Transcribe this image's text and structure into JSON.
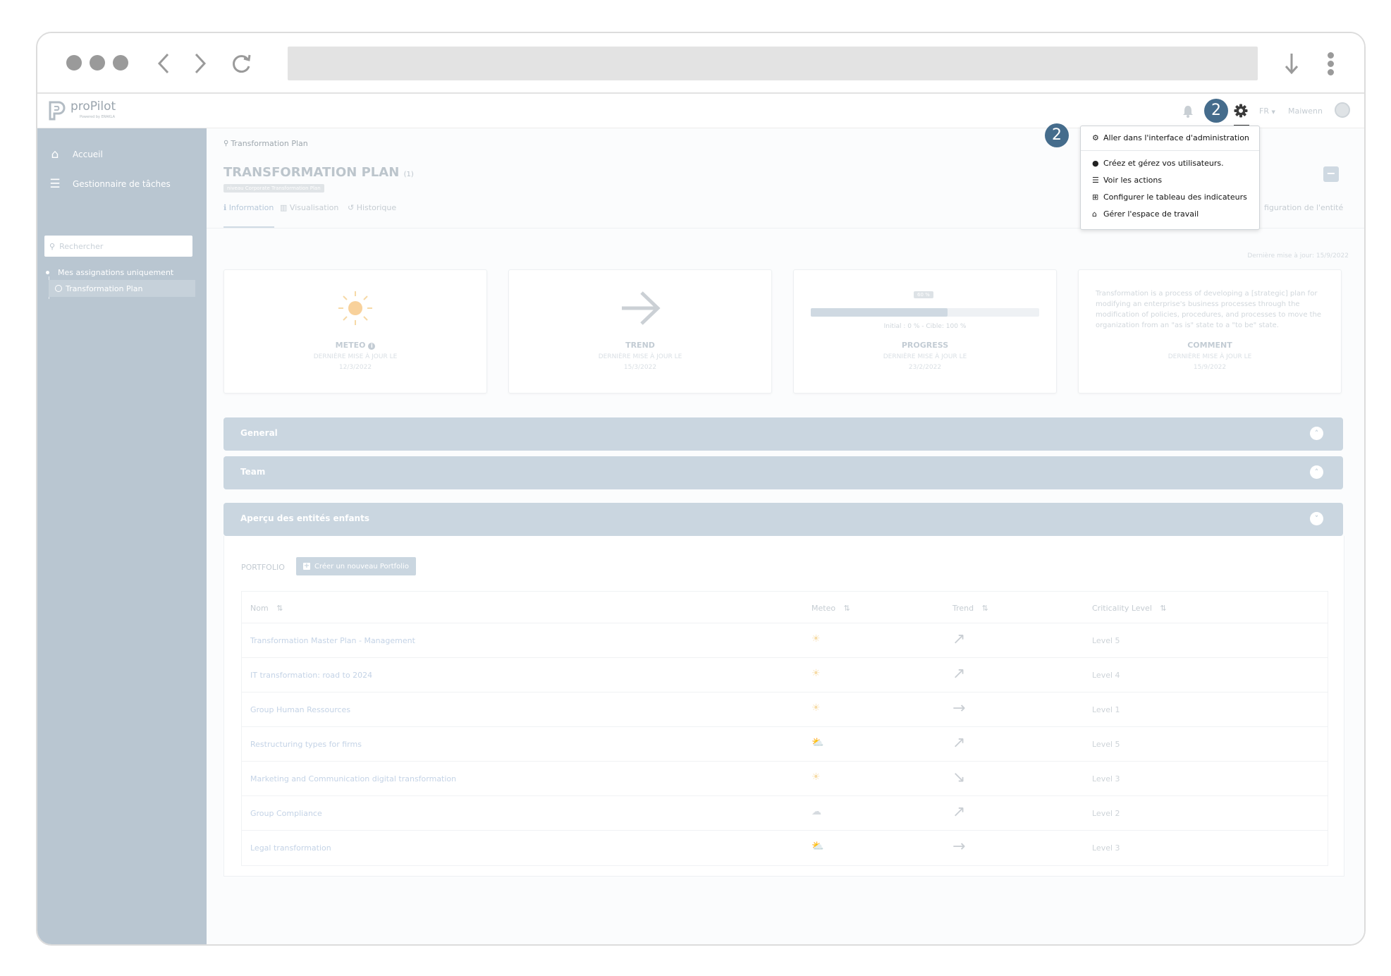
{
  "browser": {
    "back": "‹",
    "forward": "›",
    "reload": "⟳",
    "download": "↓"
  },
  "header": {
    "logo_text": "proPilot",
    "logo_sub": "Powered by ERAKLA",
    "language": "FR",
    "user_name": "Maiwenn"
  },
  "badges": {
    "gear": "2",
    "dropdown": "2"
  },
  "sidebar": {
    "items": [
      {
        "label": "Accueil",
        "icon": "home-icon"
      },
      {
        "label": "Gestionnaire de tâches",
        "icon": "tasks-icon"
      }
    ],
    "search_placeholder": "Rechercher",
    "only_mine": "Mes assignations uniquement",
    "tree_item": "Transformation Plan"
  },
  "page": {
    "breadcrumb": "Transformation Plan",
    "title": "TRANSFORMATION PLAN",
    "title_count": "(1)",
    "level_tag": "niveau Corporate Transformation Plan",
    "tabs": [
      "Information",
      "Visualisation",
      "Historique"
    ],
    "config_tab": "figuration de l'entité",
    "last_update": "Dernière mise à jour: 15/9/2022"
  },
  "cards": {
    "meteo": {
      "title": "METEO",
      "sub": "DERNIÈRE MISE À JOUR LE",
      "date": "12/3/2022"
    },
    "trend": {
      "title": "TREND",
      "sub": "DERNIÈRE MISE À JOUR LE",
      "date": "15/3/2022"
    },
    "progress": {
      "title": "PROGRESS",
      "sub": "DERNIÈRE MISE À JOUR LE",
      "date": "23/2/2022",
      "tooltip": "60 %",
      "value": 0.6,
      "range_text": "Initial : 0 % - Cible: 100 %"
    },
    "comment": {
      "title": "COMMENT",
      "sub": "DERNIÈRE MISE À JOUR LE",
      "date": "15/9/2022",
      "text": "Transformation is a process of developing a [strategic] plan for modifying an enterprise's business processes through the modification of policies, procedures, and processes to move the organization from an \"as is\" state to a \"to be\" state."
    }
  },
  "sections": {
    "general": "General",
    "team": "Team",
    "children": "Aperçu des entités enfants"
  },
  "portfolio": {
    "label": "PORTFOLIO",
    "create_button": "Créer un nouveau Portfolio",
    "columns": [
      "Nom",
      "Meteo",
      "Trend",
      "Criticality Level"
    ],
    "rows": [
      {
        "name": "Transformation Master Plan - Management",
        "meteo": "☀",
        "trend": "↗",
        "level": "Level 5"
      },
      {
        "name": "IT transformation: road to 2024",
        "meteo": "☀",
        "trend": "↗",
        "level": "Level 4"
      },
      {
        "name": "Group Human Ressources",
        "meteo": "☀",
        "trend": "→",
        "level": "Level 1"
      },
      {
        "name": "Restructuring types for firms",
        "meteo": "⛅",
        "trend": "↗",
        "level": "Level 5"
      },
      {
        "name": "Marketing and Communication digital transformation",
        "meteo": "☀",
        "trend": "↘",
        "level": "Level 3"
      },
      {
        "name": "Group Compliance",
        "meteo": "☁",
        "trend": "↗",
        "level": "Level 2"
      },
      {
        "name": "Legal transformation",
        "meteo": "⛅",
        "trend": "→",
        "level": "Level 3"
      }
    ]
  },
  "dropdown": {
    "items": [
      {
        "label": "Aller dans l'interface d'administration",
        "icon": "gear-icon"
      },
      {
        "label": "Créez et gérez vos utilisateurs.",
        "icon": "user-icon"
      },
      {
        "label": "Voir les actions",
        "icon": "list-icon"
      },
      {
        "label": "Configurer le tableau des indicateurs",
        "icon": "table-icon"
      },
      {
        "label": "Gérer l'espace de travail",
        "icon": "home-icon"
      }
    ]
  },
  "colors": {
    "sidebar": "#b9c6d1",
    "band": "#cad6e0",
    "badge": "#456c8c",
    "sun": "#f6c27a"
  }
}
